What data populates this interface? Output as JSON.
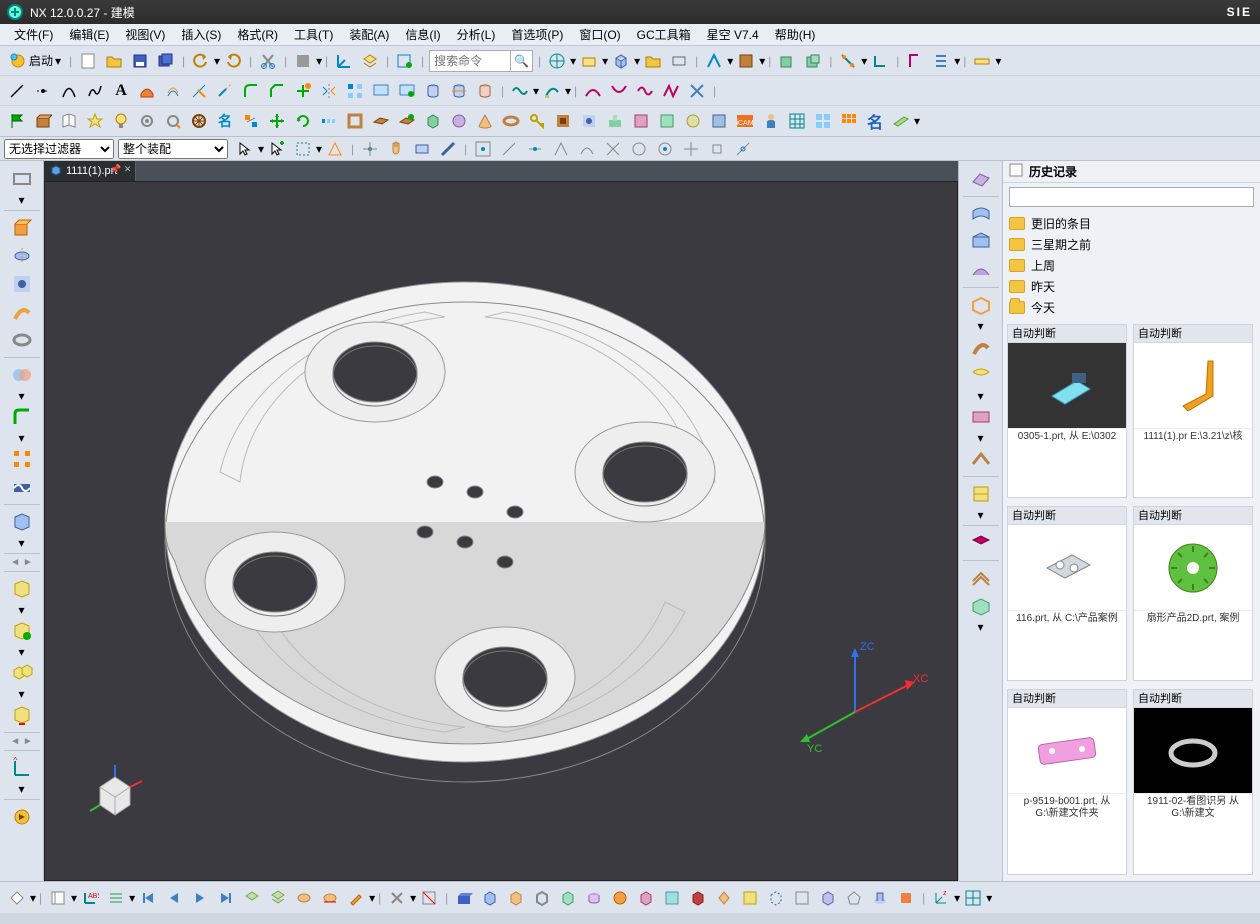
{
  "title": "NX 12.0.0.27 - 建模",
  "brand": "SIE",
  "menu": [
    "文件(F)",
    "编辑(E)",
    "视图(V)",
    "插入(S)",
    "格式(R)",
    "工具(T)",
    "装配(A)",
    "信息(I)",
    "分析(L)",
    "首选项(P)",
    "窗口(O)",
    "GC工具箱",
    "星空 V7.4",
    "帮助(H)"
  ],
  "toolbar_start_label": "启动",
  "search_placeholder": "搜索命令",
  "filter_selector_1": "无选择过滤器",
  "filter_selector_2": "整个装配",
  "doc_tab": "1111(1).prt",
  "history": {
    "title": "历史记录",
    "folders": [
      "更旧的条目",
      "三星期之前",
      "上周",
      "昨天",
      "今天"
    ],
    "thumbs": [
      {
        "head": "自动判断",
        "file": "0305-1.prt, 从 E:\\0302",
        "bg": "#333",
        "shape": "diamond"
      },
      {
        "head": "自动判断",
        "file": "1111(1).pr E:\\3.21\\z\\核",
        "bg": "#fff",
        "shape": "hook"
      },
      {
        "head": "自动判断",
        "file": "116.prt, 从 C:\\产品案例",
        "bg": "#fff",
        "shape": "block"
      },
      {
        "head": "自动判断",
        "file": "扇形产品2D.prt, 案例",
        "bg": "#fff",
        "shape": "gear"
      },
      {
        "head": "自动判断",
        "file": "p-9519-b001.prt, 从 G:\\新建文件夹",
        "bg": "#fff",
        "shape": "card"
      },
      {
        "head": "自动判断",
        "file": "1911-02-看图识另 从 G:\\新建文",
        "bg": "#000",
        "shape": "ring"
      }
    ]
  },
  "axis_labels": {
    "x": "XC",
    "y": "YC",
    "z": "ZC"
  }
}
